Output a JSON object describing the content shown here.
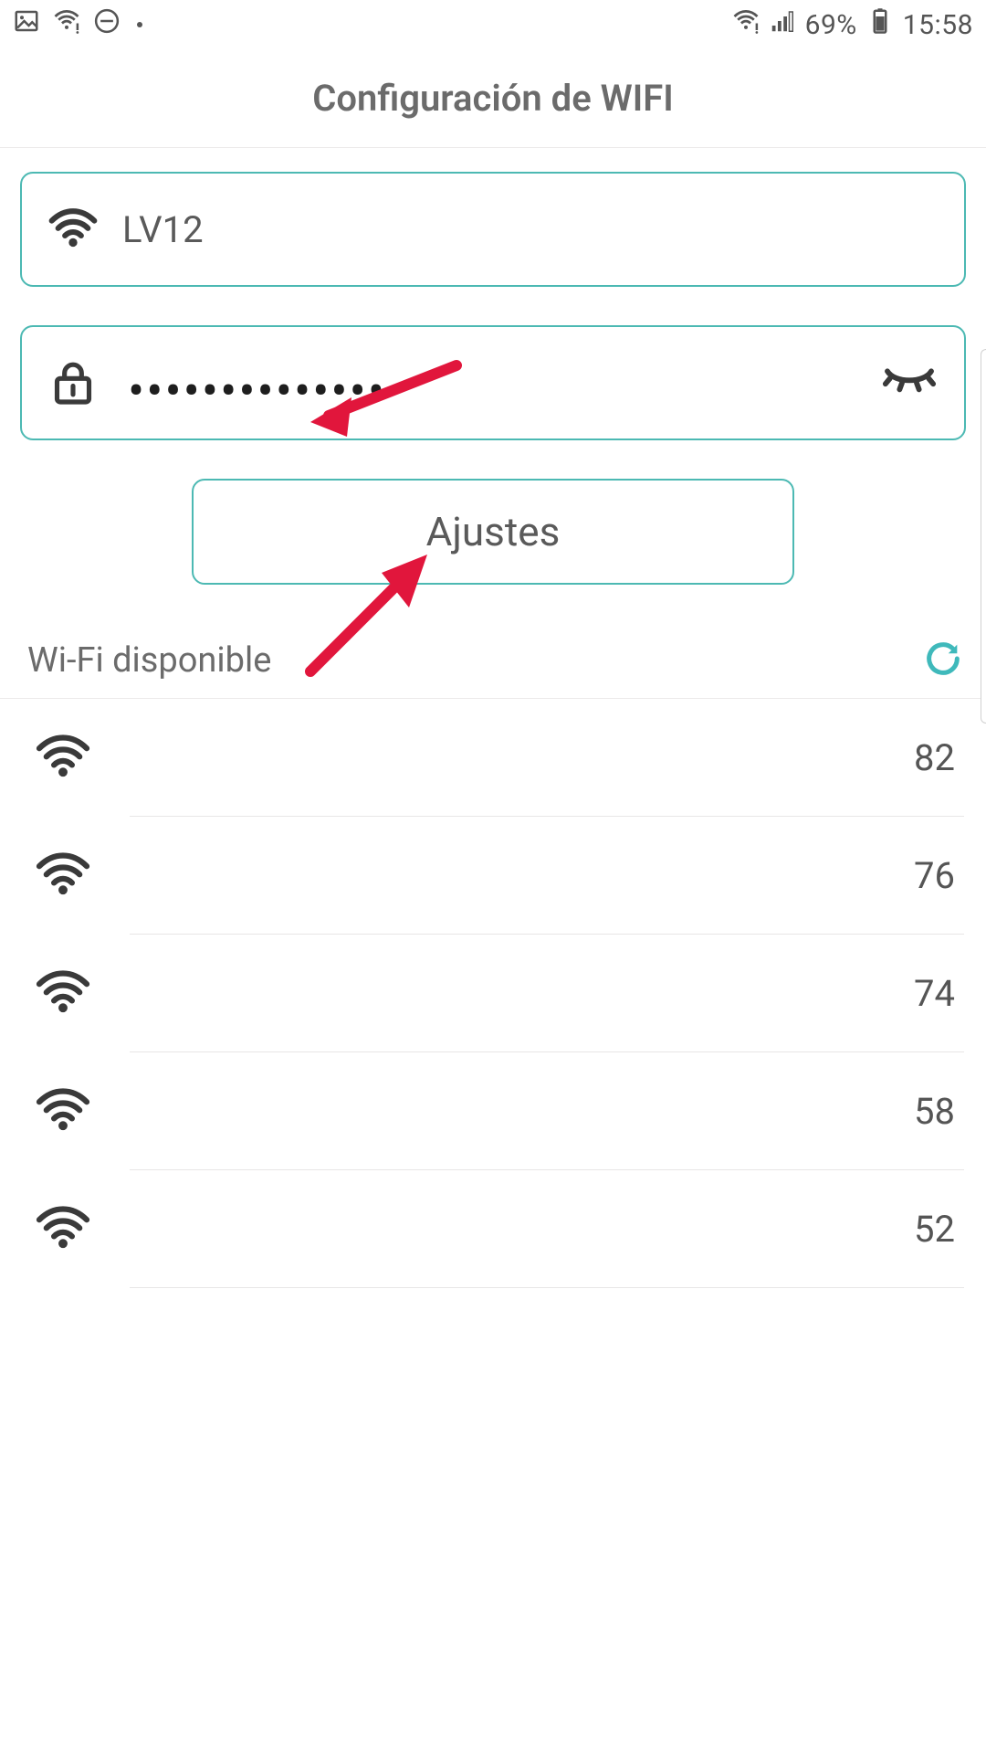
{
  "statusbar": {
    "battery_pct": "69%",
    "clock": "15:58"
  },
  "header": {
    "title": "Configuración de WIFI"
  },
  "network": {
    "ssid_value": "LV12",
    "password_masked": "••••••••••••••"
  },
  "settings_button": {
    "label": "Ajustes"
  },
  "available": {
    "label": "Wi-Fi disponible"
  },
  "networks": [
    {
      "signal": "82"
    },
    {
      "signal": "76"
    },
    {
      "signal": "74"
    },
    {
      "signal": "58"
    },
    {
      "signal": "52"
    }
  ]
}
